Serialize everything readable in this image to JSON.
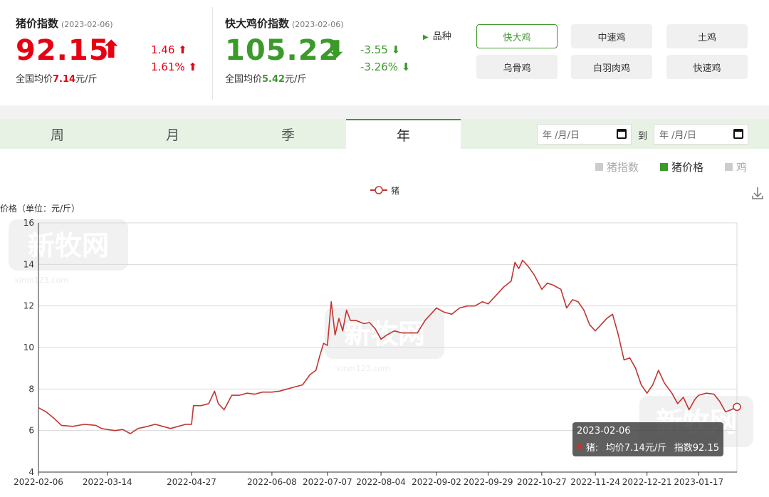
{
  "pig_index": {
    "title": "猪价指数",
    "date": "(2023-02-06)",
    "value": "92.15",
    "arrow": "⬆",
    "change": "1.46 ⬆",
    "change_pct": "1.61% ⬆",
    "avg_prefix": "全国均价",
    "avg_value": "7.14",
    "avg_unit": "元/斤",
    "color": "#e60012"
  },
  "chicken_index": {
    "title": "快大鸡价指数",
    "date": "(2023-02-06)",
    "value": "105.22",
    "arrow": "⬇",
    "change": "-3.55 ⬇",
    "change_pct": "-3.26% ⬇",
    "avg_prefix": "全国均价",
    "avg_value": "5.42",
    "avg_unit": "元/斤",
    "color": "#3c9a2b"
  },
  "variety": {
    "label": "品种",
    "buttons": [
      "快大鸡",
      "中速鸡",
      "土鸡",
      "乌骨鸡",
      "白羽肉鸡",
      "快速鸡"
    ],
    "selected": "快大鸡"
  },
  "tabs": [
    "周",
    "月",
    "季",
    "年"
  ],
  "active_tab": "年",
  "date_range": {
    "start_placeholder": "年 /月/日",
    "end_placeholder": "年 /月/日",
    "to_label": "到"
  },
  "toggles": [
    {
      "label": "猪指数",
      "color": "#cccccc",
      "active": false
    },
    {
      "label": "猪价格",
      "color": "#3c9a2b",
      "active": true
    },
    {
      "label": "鸡",
      "color": "#cccccc",
      "active": false
    }
  ],
  "tooltip": {
    "date": "2023-02-06",
    "series": "猪:",
    "avg": "均价7.14元/斤",
    "index": "指数92.15"
  },
  "watermark": "新牧网",
  "watermark_url": "xinm123.com",
  "chart_data": {
    "type": "line",
    "ylabel": "价格（单位：元/斤）",
    "ylim": [
      4,
      16
    ],
    "yticks": [
      4,
      6,
      8,
      10,
      12,
      14,
      16
    ],
    "x_range": [
      "2022-02-06",
      "2023-02-06"
    ],
    "xticks": [
      "2022-02-06",
      "2022-03-14",
      "2022-04-27",
      "2022-06-08",
      "2022-07-07",
      "2022-08-04",
      "2022-09-02",
      "2022-09-29",
      "2022-10-27",
      "2022-11-24",
      "2022-12-21",
      "2023-01-17"
    ],
    "legend": "top-center",
    "grid": true,
    "series": [
      {
        "name": "猪",
        "color": "#c23531",
        "points": [
          [
            "2022-02-06",
            7.1
          ],
          [
            "2022-02-10",
            6.9
          ],
          [
            "2022-02-14",
            6.6
          ],
          [
            "2022-02-18",
            6.25
          ],
          [
            "2022-02-24",
            6.2
          ],
          [
            "2022-03-02",
            6.3
          ],
          [
            "2022-03-08",
            6.25
          ],
          [
            "2022-03-11",
            6.1
          ],
          [
            "2022-03-14",
            6.05
          ],
          [
            "2022-03-18",
            6.0
          ],
          [
            "2022-03-22",
            6.05
          ],
          [
            "2022-03-26",
            5.85
          ],
          [
            "2022-03-30",
            6.1
          ],
          [
            "2022-04-04",
            6.2
          ],
          [
            "2022-04-08",
            6.3
          ],
          [
            "2022-04-12",
            6.2
          ],
          [
            "2022-04-16",
            6.1
          ],
          [
            "2022-04-20",
            6.2
          ],
          [
            "2022-04-24",
            6.3
          ],
          [
            "2022-04-27",
            6.3
          ],
          [
            "2022-04-28",
            7.2
          ],
          [
            "2022-05-02",
            7.2
          ],
          [
            "2022-05-06",
            7.3
          ],
          [
            "2022-05-09",
            7.9
          ],
          [
            "2022-05-11",
            7.3
          ],
          [
            "2022-05-14",
            7.0
          ],
          [
            "2022-05-18",
            7.7
          ],
          [
            "2022-05-22",
            7.7
          ],
          [
            "2022-05-26",
            7.8
          ],
          [
            "2022-05-30",
            7.75
          ],
          [
            "2022-06-03",
            7.85
          ],
          [
            "2022-06-08",
            7.85
          ],
          [
            "2022-06-12",
            7.9
          ],
          [
            "2022-06-16",
            8.0
          ],
          [
            "2022-06-20",
            8.1
          ],
          [
            "2022-06-24",
            8.2
          ],
          [
            "2022-06-28",
            8.7
          ],
          [
            "2022-07-01",
            8.9
          ],
          [
            "2022-07-03",
            9.6
          ],
          [
            "2022-07-05",
            10.2
          ],
          [
            "2022-07-07",
            10.1
          ],
          [
            "2022-07-09",
            12.2
          ],
          [
            "2022-07-11",
            10.6
          ],
          [
            "2022-07-13",
            11.4
          ],
          [
            "2022-07-15",
            10.8
          ],
          [
            "2022-07-17",
            11.8
          ],
          [
            "2022-07-19",
            11.3
          ],
          [
            "2022-07-22",
            11.3
          ],
          [
            "2022-07-26",
            11.15
          ],
          [
            "2022-07-29",
            11.2
          ],
          [
            "2022-08-01",
            10.9
          ],
          [
            "2022-08-04",
            10.4
          ],
          [
            "2022-08-07",
            10.6
          ],
          [
            "2022-08-11",
            10.8
          ],
          [
            "2022-08-15",
            10.7
          ],
          [
            "2022-08-19",
            10.7
          ],
          [
            "2022-08-23",
            10.7
          ],
          [
            "2022-08-27",
            11.3
          ],
          [
            "2022-08-30",
            11.6
          ],
          [
            "2022-09-02",
            11.9
          ],
          [
            "2022-09-06",
            11.7
          ],
          [
            "2022-09-10",
            11.6
          ],
          [
            "2022-09-14",
            11.9
          ],
          [
            "2022-09-18",
            12.0
          ],
          [
            "2022-09-22",
            12.0
          ],
          [
            "2022-09-26",
            12.2
          ],
          [
            "2022-09-29",
            12.1
          ],
          [
            "2022-10-03",
            12.5
          ],
          [
            "2022-10-07",
            12.9
          ],
          [
            "2022-10-11",
            13.2
          ],
          [
            "2022-10-13",
            14.1
          ],
          [
            "2022-10-15",
            13.8
          ],
          [
            "2022-10-17",
            14.2
          ],
          [
            "2022-10-20",
            13.9
          ],
          [
            "2022-10-23",
            13.5
          ],
          [
            "2022-10-27",
            12.8
          ],
          [
            "2022-10-30",
            13.1
          ],
          [
            "2022-11-02",
            13.0
          ],
          [
            "2022-11-06",
            12.8
          ],
          [
            "2022-11-09",
            11.9
          ],
          [
            "2022-11-12",
            12.3
          ],
          [
            "2022-11-15",
            12.2
          ],
          [
            "2022-11-18",
            11.8
          ],
          [
            "2022-11-21",
            11.1
          ],
          [
            "2022-11-24",
            10.8
          ],
          [
            "2022-11-27",
            11.1
          ],
          [
            "2022-11-30",
            11.4
          ],
          [
            "2022-12-03",
            11.6
          ],
          [
            "2022-12-06",
            10.6
          ],
          [
            "2022-12-09",
            9.4
          ],
          [
            "2022-12-12",
            9.5
          ],
          [
            "2022-12-15",
            9.0
          ],
          [
            "2022-12-18",
            8.2
          ],
          [
            "2022-12-21",
            7.8
          ],
          [
            "2022-12-24",
            8.2
          ],
          [
            "2022-12-27",
            8.9
          ],
          [
            "2022-12-30",
            8.3
          ],
          [
            "2023-01-03",
            7.8
          ],
          [
            "2023-01-06",
            7.3
          ],
          [
            "2023-01-09",
            7.6
          ],
          [
            "2023-01-12",
            7.0
          ],
          [
            "2023-01-15",
            7.5
          ],
          [
            "2023-01-17",
            7.7
          ],
          [
            "2023-01-21",
            7.8
          ],
          [
            "2023-01-25",
            7.75
          ],
          [
            "2023-01-28",
            7.4
          ],
          [
            "2023-01-31",
            6.9
          ],
          [
            "2023-02-03",
            7.0
          ],
          [
            "2023-02-06",
            7.14
          ]
        ]
      }
    ]
  }
}
